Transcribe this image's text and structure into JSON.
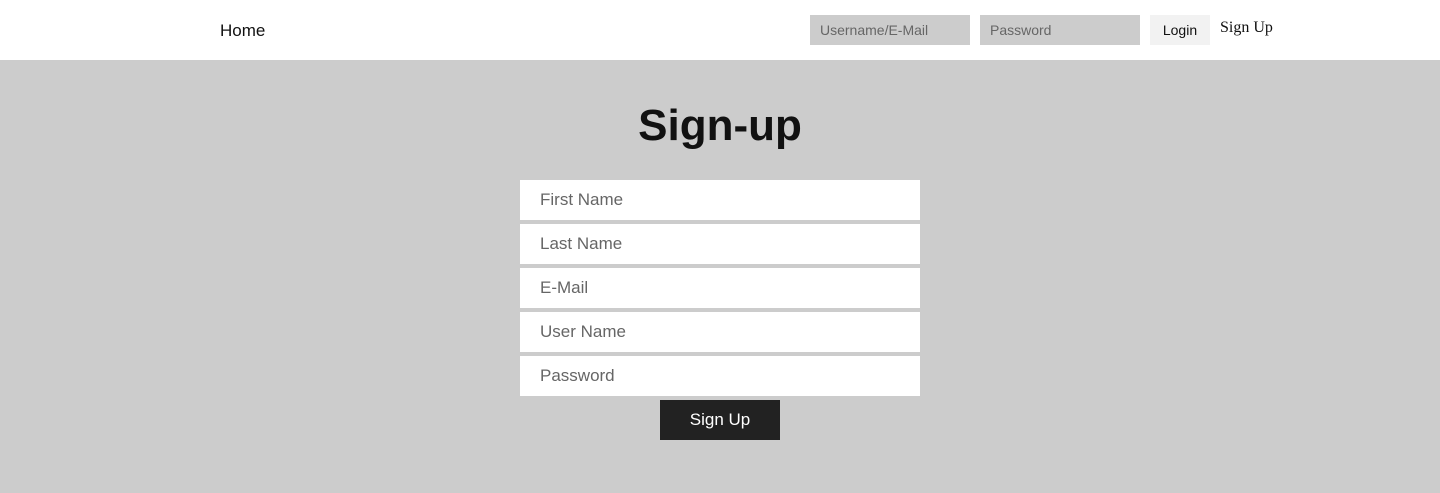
{
  "nav": {
    "home_label": "Home",
    "login_username_placeholder": "Username/E-Mail",
    "login_password_placeholder": "Password",
    "login_label": "Login",
    "signup_link_label": "Sign Up"
  },
  "main": {
    "title": "Sign-up",
    "fields": {
      "first_name_placeholder": "First Name",
      "last_name_placeholder": "Last Name",
      "email_placeholder": "E-Mail",
      "username_placeholder": "User Name",
      "password_placeholder": "Password"
    },
    "submit_label": "Sign Up"
  },
  "colors": {
    "background": "#cccccc",
    "topbar": "#ffffff",
    "submit_button": "#222222"
  }
}
